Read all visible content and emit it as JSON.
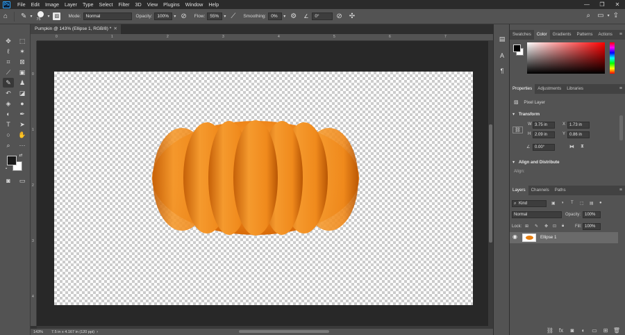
{
  "app": {
    "logo": "Ps",
    "menu": [
      "File",
      "Edit",
      "Image",
      "Layer",
      "Type",
      "Select",
      "Filter",
      "3D",
      "View",
      "Plugins",
      "Window",
      "Help"
    ],
    "window_controls": [
      "—",
      "❐",
      "✕"
    ]
  },
  "options": {
    "brush_size": "75",
    "mode_label": "Mode:",
    "mode_value": "Normal",
    "opacity_label": "Opacity:",
    "opacity_value": "100%",
    "flow_label": "Flow:",
    "flow_value": "55%",
    "smoothing_label": "Smoothing:",
    "smoothing_value": "0%",
    "angle_value": "0°"
  },
  "document": {
    "tab_title": "Pumpkin @ 143% (Ellipse 1, RGB/8) *",
    "zoom": "143%",
    "info": "7.5 in x 4.167 in (120 ppi)",
    "ruler_top": [
      "0",
      "1",
      "2",
      "3",
      "4",
      "5",
      "6",
      "7"
    ],
    "ruler_left": [
      "0",
      "1",
      "2",
      "3",
      "4"
    ]
  },
  "panels": {
    "color_tabs": [
      "Swatches",
      "Color",
      "Gradients",
      "Patterns",
      "Actions"
    ],
    "properties_tabs": [
      "Properties",
      "Adjustments",
      "Libraries"
    ],
    "layer_type": "Pixel Layer",
    "transform_title": "Transform",
    "w_label": "W",
    "w_value": "3.75 in",
    "x_label": "X",
    "x_value": "1.73 in",
    "h_label": "H",
    "h_value": "2.09 in",
    "y_label": "Y",
    "y_value": "0.86 in",
    "angle_value": "0.00°",
    "align_title": "Align and Distribute",
    "align_sub": "Align:",
    "layers_tabs": [
      "Layers",
      "Channels",
      "Paths"
    ],
    "kind_label": "Kind",
    "blend_mode": "Normal",
    "opacity_label": "Opacity:",
    "opacity_value": "100%",
    "lock_label": "Lock:",
    "fill_label": "Fill:",
    "fill_value": "100%",
    "layer_name": "Ellipse 1"
  }
}
